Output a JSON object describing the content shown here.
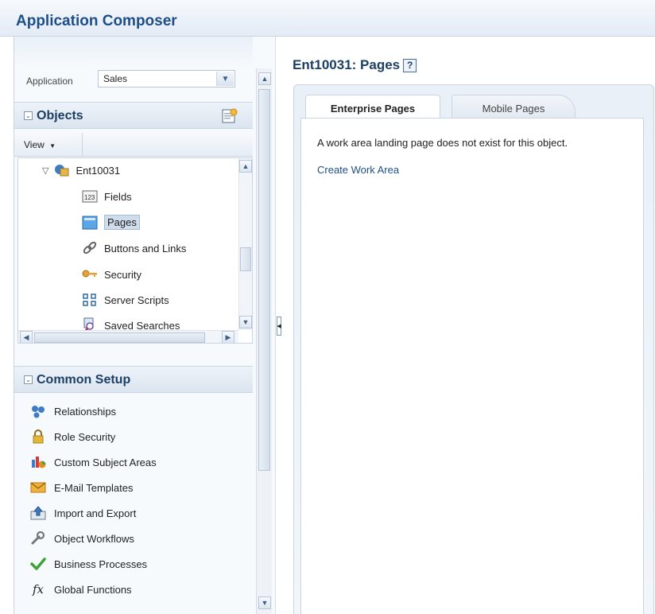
{
  "app": {
    "title": "Application Composer"
  },
  "application_selector": {
    "label": "Application",
    "value": "Sales"
  },
  "objects_section": {
    "title": "Objects",
    "view_menu": "View",
    "tree_root": "Ent10031",
    "tree_items": [
      {
        "label": "Fields",
        "icon": "fields-icon"
      },
      {
        "label": "Pages",
        "icon": "pages-icon",
        "selected": true
      },
      {
        "label": "Buttons and Links",
        "icon": "link-icon"
      },
      {
        "label": "Security",
        "icon": "key-icon"
      },
      {
        "label": "Server Scripts",
        "icon": "scripts-icon"
      },
      {
        "label": "Saved Searches",
        "icon": "saved-search-icon"
      }
    ]
  },
  "common_setup": {
    "title": "Common Setup",
    "items": [
      {
        "label": "Relationships",
        "icon": "relationships-icon"
      },
      {
        "label": "Role Security",
        "icon": "lock-icon"
      },
      {
        "label": "Custom Subject Areas",
        "icon": "subject-areas-icon"
      },
      {
        "label": "E-Mail Templates",
        "icon": "email-icon"
      },
      {
        "label": "Import and Export",
        "icon": "import-export-icon"
      },
      {
        "label": "Object Workflows",
        "icon": "wrench-icon"
      },
      {
        "label": "Business Processes",
        "icon": "checkmark-icon"
      },
      {
        "label": "Global Functions",
        "icon": "function-icon"
      }
    ]
  },
  "main": {
    "title": "Ent10031: Pages",
    "help_glyph": "?",
    "tabs": [
      {
        "label": "Enterprise Pages",
        "active": true
      },
      {
        "label": "Mobile Pages",
        "active": false
      }
    ],
    "message": "A work area landing page does not exist for this object.",
    "create_link": "Create Work Area"
  },
  "colors": {
    "title_blue": "#1d4f86",
    "link_blue": "#1d4f86",
    "selection": "#cfdcec"
  }
}
